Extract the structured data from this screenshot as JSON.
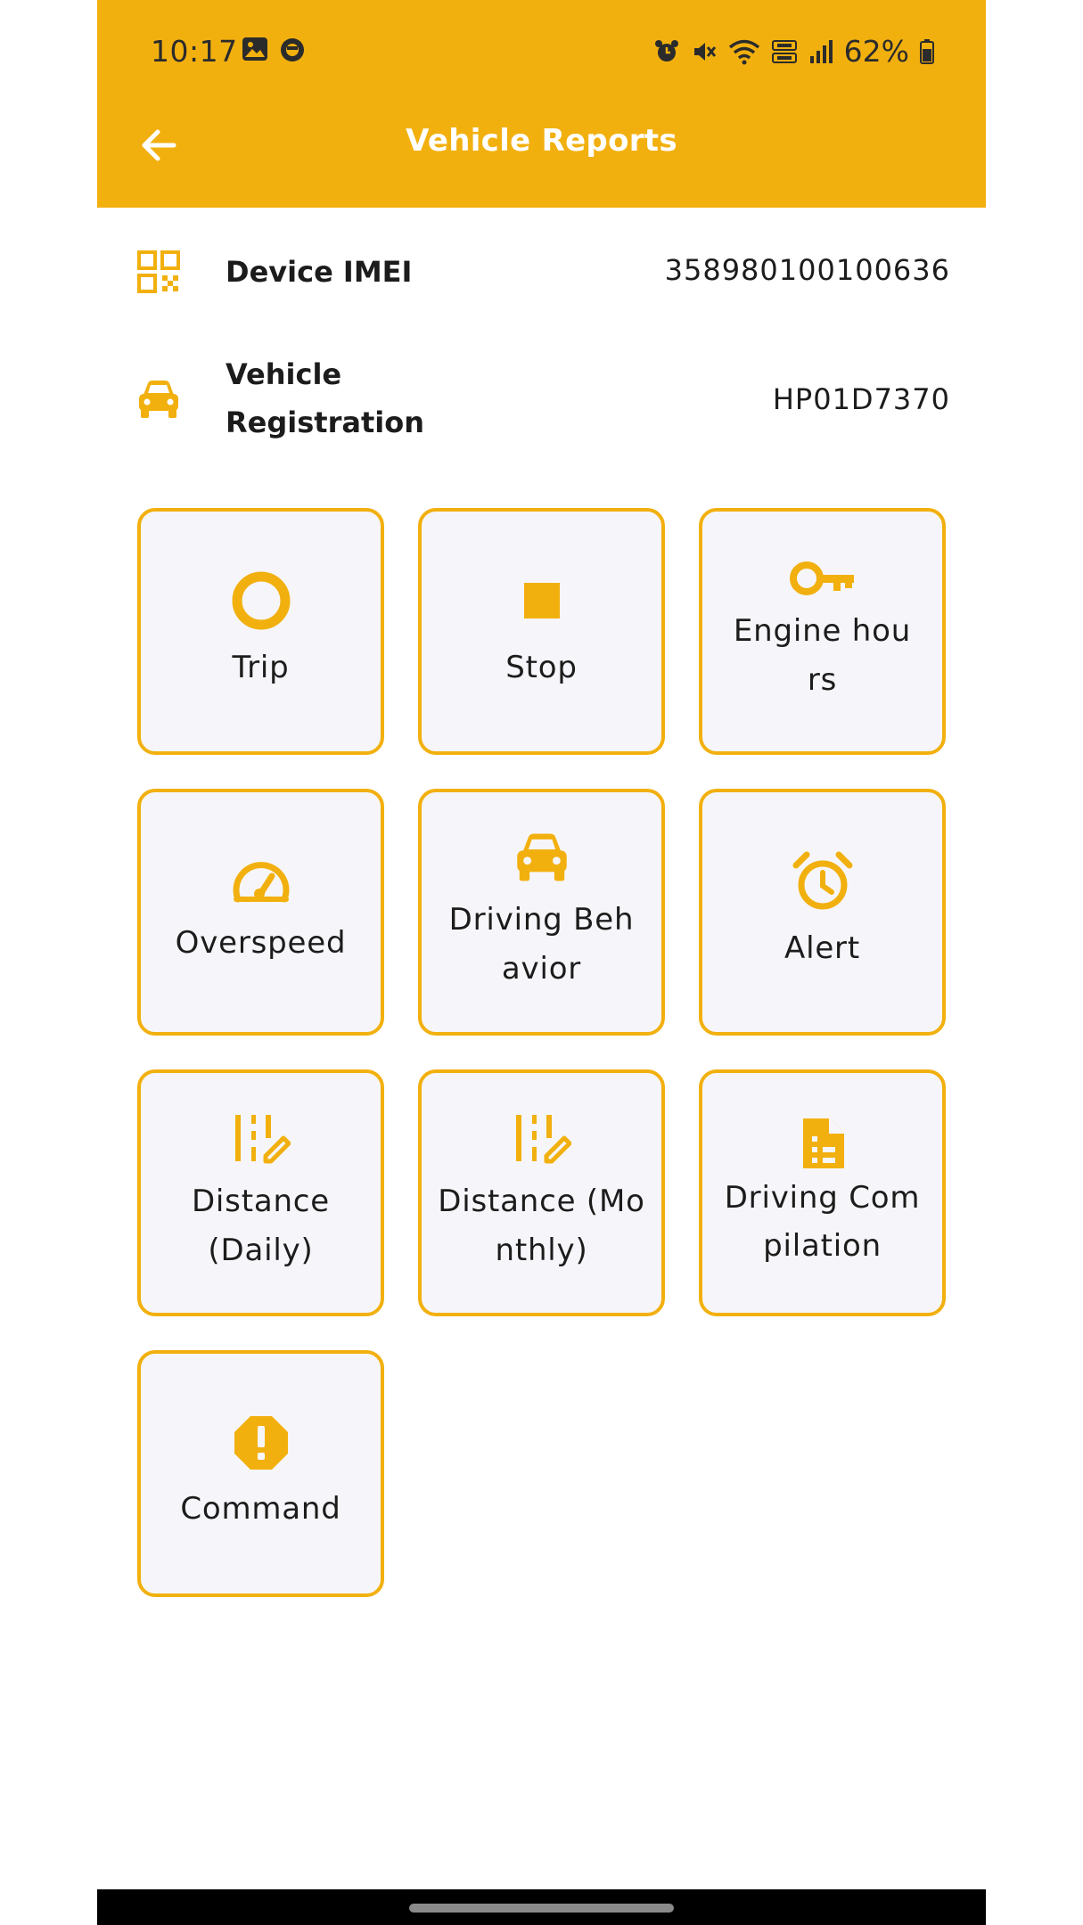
{
  "status_bar": {
    "time": "10:17",
    "battery": "62%",
    "left_icons": [
      "gallery-icon",
      "app-notification-icon"
    ],
    "right_icons": [
      "alarm-icon",
      "mute-icon",
      "wifi-icon",
      "volte-icon",
      "signal-icon",
      "battery-icon"
    ]
  },
  "app_bar": {
    "title": "Vehicle Reports",
    "back_icon": "arrow-left-icon"
  },
  "info": {
    "imei": {
      "label": "Device IMEI",
      "value": "358980100100636",
      "icon": "qr-code-icon"
    },
    "registration": {
      "label_line1": "Vehicle",
      "label_line2": "Registration",
      "value": "HP01D7370",
      "icon": "car-icon"
    }
  },
  "tiles": [
    {
      "label": "Trip",
      "icon": "ring-icon"
    },
    {
      "label": "Stop",
      "icon": "stop-square-icon"
    },
    {
      "label": "Engine hours",
      "icon": "key-icon"
    },
    {
      "label": "Overspeed",
      "icon": "speedometer-icon"
    },
    {
      "label": "Driving Behavior",
      "icon": "car-icon"
    },
    {
      "label": "Alert",
      "icon": "alarm-clock-icon"
    },
    {
      "label": "Distance (Daily)",
      "icon": "road-edit-icon"
    },
    {
      "label": "Distance (Monthly)",
      "icon": "road-edit-icon"
    },
    {
      "label": "Driving Compilation",
      "icon": "document-icon"
    },
    {
      "label": "Command",
      "icon": "warning-octagon-icon"
    }
  ],
  "colors": {
    "accent": "#F2B00F",
    "tile_bg": "#F6F6FA",
    "text": "#1C1C1C",
    "title_text": "#FFFFFF"
  }
}
